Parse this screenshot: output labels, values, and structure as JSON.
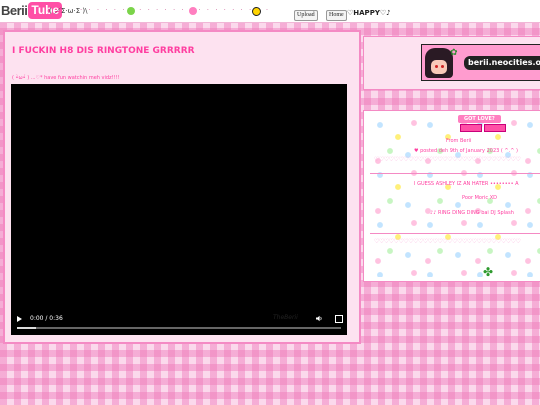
{
  "topbar": {
    "logo_part1": "Berii",
    "logo_part2": "Tube",
    "kaomoji": "( ／Σ·ω·Σ )\\",
    "upload_label": "Upload",
    "home_label": "Home",
    "happy_text": "HAPPY",
    "colors": {
      "logo_tube_bg": "#ff4fa6",
      "face_green": "#7bd44a",
      "face_pink": "#ff7fc0",
      "face_yellow": "#ffd400"
    }
  },
  "main": {
    "video_title": "I FUCKIN H8 DIS RINGTONE GRRRRR",
    "subline": "( •̀ω•́ ) ...♡* have fun watchin meh vidz!!!!",
    "player": {
      "time": "0:00 / 0:36",
      "watermark": "TheBerii",
      "progress": 0.06
    }
  },
  "sidebar": {
    "banner_url": "berii.neocities.org"
  },
  "comments": {
    "header": "GOT LOVE?",
    "entries": [
      {
        "line1": "From Berii",
        "line2": "posted deh 9th of January 2023 ( ^.^ )"
      },
      {
        "line1": "I GUESS ASHLEY IZ AN HATER •••••••• A",
        "line2": "Poor Moric XD",
        "line3": "RING DING DING bai DJ Splash"
      }
    ]
  },
  "colors": {
    "accent": "#ff3ea0",
    "border": "#f48ac4",
    "bg_pink": "#fbd9ec"
  }
}
